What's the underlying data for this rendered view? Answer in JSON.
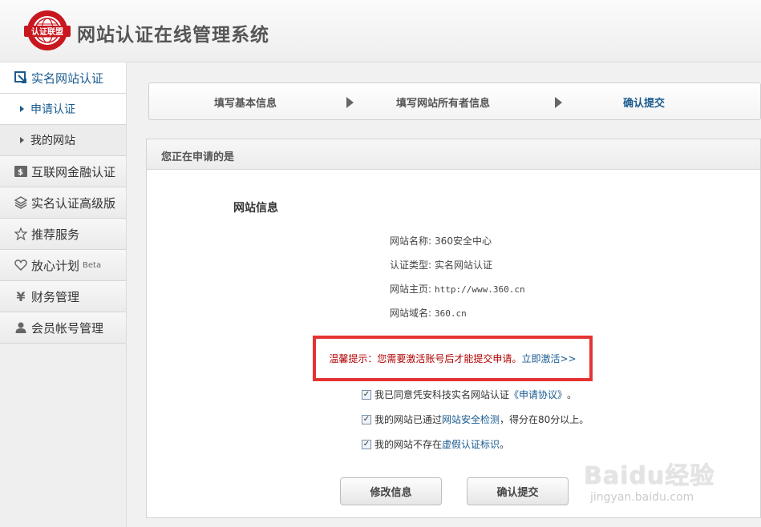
{
  "header": {
    "logo_text": "认证联盟",
    "title": "网站认证在线管理系统"
  },
  "sidebar": {
    "items": [
      {
        "label": "实名网站认证",
        "icon": "verify-icon"
      },
      {
        "label": "申请认证"
      },
      {
        "label": "我的网站"
      },
      {
        "label": "互联网金融认证",
        "icon": "finance-icon"
      },
      {
        "label": "实名认证高级版",
        "icon": "layers-icon"
      },
      {
        "label": "推荐服务",
        "icon": "star-icon"
      },
      {
        "label": "放心计划",
        "icon": "heart-icon",
        "badge": "Beta"
      },
      {
        "label": "财务管理",
        "icon": "yen-icon"
      },
      {
        "label": "会员帐号管理",
        "icon": "user-icon"
      }
    ]
  },
  "steps": {
    "step1": "填写基本信息",
    "step2": "填写网站所有者信息",
    "step3": "确认提交"
  },
  "panel": {
    "heading": "您正在申请的是",
    "section_title": "网站信息",
    "fields": [
      {
        "label": "网站名称:",
        "value": "360安全中心"
      },
      {
        "label": "认证类型:",
        "value": "实名网站认证"
      },
      {
        "label": "网站主页:",
        "value": "http://www.360.cn"
      },
      {
        "label": "网站域名:",
        "value": "360.cn"
      }
    ],
    "notice": {
      "text": "温馨提示：您需要激活账号后才能提交申请。",
      "link": "立即激活>>"
    },
    "checks": [
      {
        "before": "我已同意凭安科技实名网站认证",
        "link": "《申请协议》",
        "after": "。"
      },
      {
        "before": "我的网站已通过",
        "link": "网站安全检测",
        "after": "，得分在80分以上。"
      },
      {
        "before": "我的网站不存在",
        "link": "虚假认证标识",
        "after": "。"
      }
    ],
    "buttons": {
      "edit": "修改信息",
      "submit": "确认提交"
    }
  },
  "watermark": {
    "brand": "Baidu经验",
    "url": "jingyan.baidu.com"
  },
  "colors": {
    "accent": "#1a5b8f",
    "notice_border": "#e53333",
    "notice_text": "#b20000",
    "logo_red": "#c8171e"
  }
}
